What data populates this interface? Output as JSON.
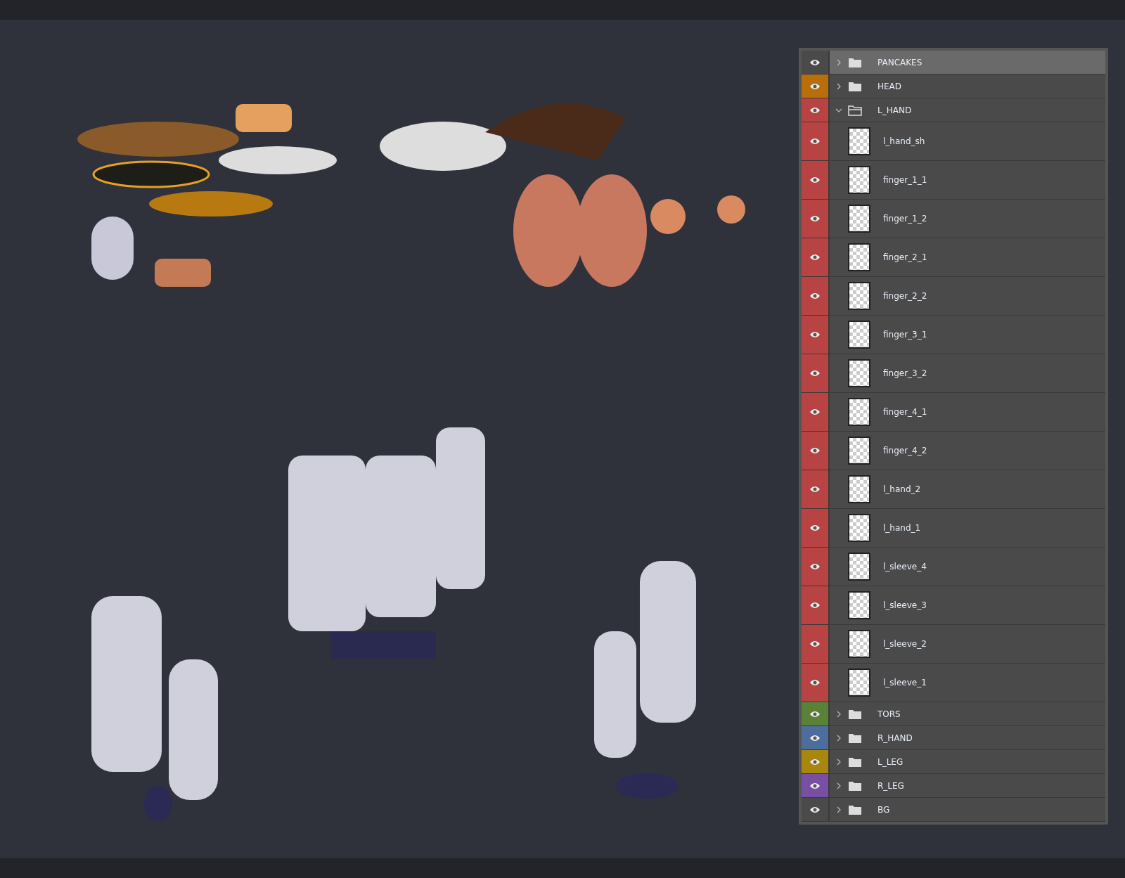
{
  "layers_panel": {
    "layers": [
      {
        "name": "PANCAKES",
        "kind": "group",
        "expanded": false,
        "selected": true
      },
      {
        "name": "HEAD",
        "kind": "group",
        "expanded": false,
        "selected": false,
        "color": "#b86e0b"
      },
      {
        "name": "L_HAND",
        "kind": "group",
        "expanded": true,
        "selected": false,
        "color": "#b84343",
        "children": [
          {
            "name": "l_hand_sh",
            "kind": "layer",
            "selected": false
          },
          {
            "name": "finger_1_1",
            "kind": "layer",
            "selected": false
          },
          {
            "name": "finger_1_2",
            "kind": "layer",
            "selected": false
          },
          {
            "name": "finger_2_1",
            "kind": "layer",
            "selected": false
          },
          {
            "name": "finger_2_2",
            "kind": "layer",
            "selected": false
          },
          {
            "name": "finger_3_1",
            "kind": "layer",
            "selected": false
          },
          {
            "name": "finger_3_2",
            "kind": "layer",
            "selected": false
          },
          {
            "name": "finger_4_1",
            "kind": "layer",
            "selected": false
          },
          {
            "name": "finger_4_2",
            "kind": "layer",
            "selected": false
          },
          {
            "name": "l_hand_2",
            "kind": "layer",
            "selected": false
          },
          {
            "name": "l_hand_1",
            "kind": "layer",
            "selected": false
          },
          {
            "name": "l_sleeve_4",
            "kind": "layer",
            "selected": false
          },
          {
            "name": "l_sleeve_3",
            "kind": "layer",
            "selected": false
          },
          {
            "name": "l_sleeve_2",
            "kind": "layer",
            "selected": false
          },
          {
            "name": "l_sleeve_1",
            "kind": "layer",
            "selected": false
          }
        ]
      },
      {
        "name": "TORS",
        "kind": "group",
        "expanded": false,
        "selected": false,
        "color": "#5a8236"
      },
      {
        "name": "R_HAND",
        "kind": "group",
        "expanded": false,
        "selected": false,
        "color": "#4d6d9c"
      },
      {
        "name": "L_LEG",
        "kind": "group",
        "expanded": false,
        "selected": false,
        "color": "#a8870e"
      },
      {
        "name": "R_LEG",
        "kind": "group",
        "expanded": false,
        "selected": false,
        "color": "#7850a3"
      },
      {
        "name": "BG",
        "kind": "group",
        "expanded": false,
        "selected": false
      }
    ]
  }
}
